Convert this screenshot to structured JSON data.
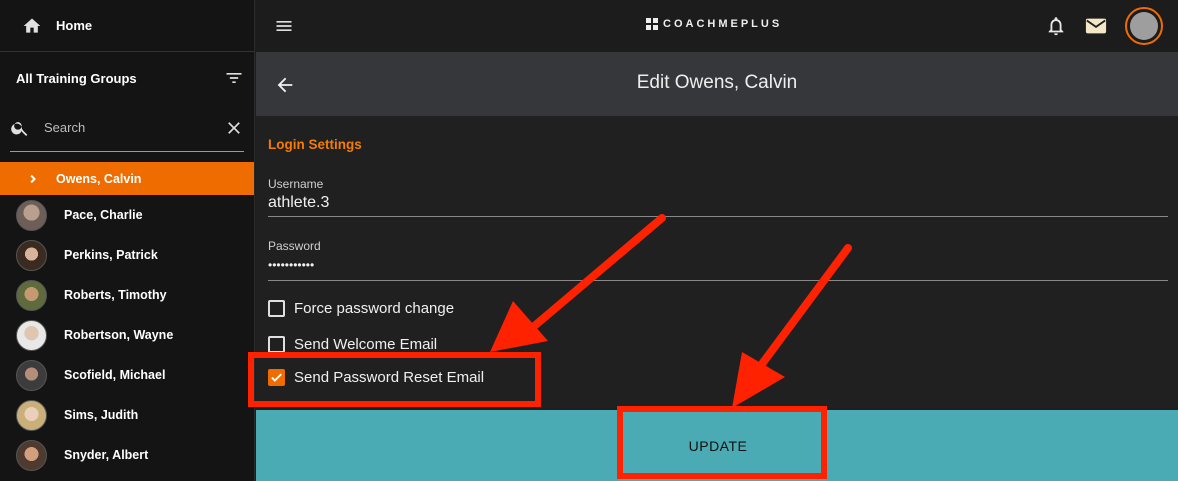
{
  "sidebar": {
    "home_label": "Home",
    "groups_label": "All Training Groups",
    "search_placeholder": "Search",
    "athletes": [
      {
        "name": "Owens, Calvin",
        "selected": true
      },
      {
        "name": "Pace, Charlie"
      },
      {
        "name": "Perkins, Patrick"
      },
      {
        "name": "Roberts, Timothy"
      },
      {
        "name": "Robertson, Wayne"
      },
      {
        "name": "Scofield, Michael"
      },
      {
        "name": "Sims, Judith"
      },
      {
        "name": "Snyder, Albert"
      }
    ]
  },
  "topbar": {
    "brand": "COACHMEPLUS"
  },
  "header": {
    "title": "Edit Owens, Calvin"
  },
  "form": {
    "section_title": "Login Settings",
    "username_label": "Username",
    "username_value": "athlete.3",
    "password_label": "Password",
    "password_value": "•••••••••••",
    "force_change_label": "Force password change",
    "force_change_checked": false,
    "welcome_email_label": "Send Welcome Email",
    "welcome_email_checked": false,
    "reset_email_label": "Send Password Reset Email",
    "reset_email_checked": true
  },
  "actions": {
    "update_label": "UPDATE"
  },
  "colors": {
    "accent": "#ef6c00",
    "update_bar": "#4aabb5",
    "annotation": "#ff2200"
  }
}
